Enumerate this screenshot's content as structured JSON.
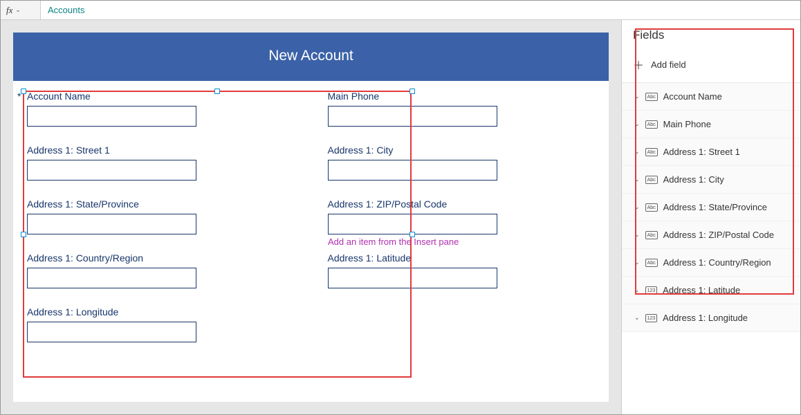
{
  "formulaBar": {
    "fx": "fx",
    "value": "Accounts"
  },
  "form": {
    "headerTitle": "New Account",
    "requiredMark": "*",
    "hint": "Add an item from the Insert pane",
    "fields": [
      {
        "label": "Account Name",
        "required": true
      },
      {
        "label": "Main Phone"
      },
      {
        "label": "Address 1: Street 1"
      },
      {
        "label": "Address 1: City"
      },
      {
        "label": "Address 1: State/Province"
      },
      {
        "label": "Address 1: ZIP/Postal Code"
      },
      {
        "label": "Address 1: Country/Region"
      },
      {
        "label": "Address 1: Latitude"
      },
      {
        "label": "Address 1: Longitude"
      }
    ]
  },
  "pane": {
    "title": "Fields",
    "addLabel": "Add field",
    "items": [
      {
        "label": "Account Name",
        "type": "Abc"
      },
      {
        "label": "Main Phone",
        "type": "Abc"
      },
      {
        "label": "Address 1: Street 1",
        "type": "Abc"
      },
      {
        "label": "Address 1: City",
        "type": "Abc"
      },
      {
        "label": "Address 1: State/Province",
        "type": "Abc"
      },
      {
        "label": "Address 1: ZIP/Postal Code",
        "type": "Abc"
      },
      {
        "label": "Address 1: Country/Region",
        "type": "Abc"
      },
      {
        "label": "Address 1: Latitude",
        "type": "123"
      },
      {
        "label": "Address 1: Longitude",
        "type": "123"
      }
    ]
  }
}
